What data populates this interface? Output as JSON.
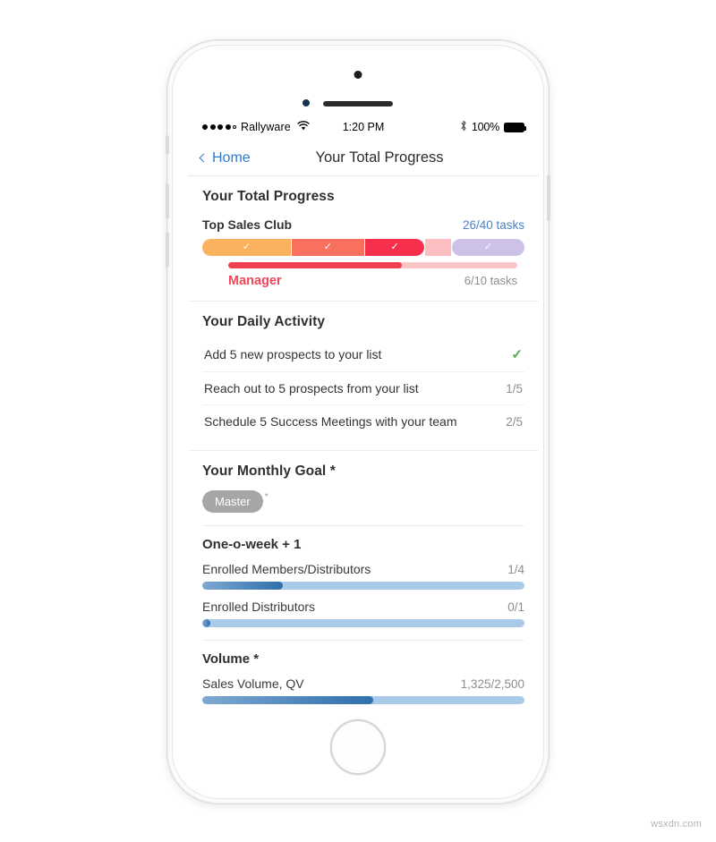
{
  "status_bar": {
    "signal_icon": "signal-dots",
    "carrier": "Rallyware",
    "wifi_icon": "wifi-icon",
    "time": "1:20 PM",
    "bluetooth_icon": "bluetooth-icon",
    "battery_percent": "100%",
    "battery_icon": "battery-full-icon"
  },
  "nav_bar": {
    "back_icon": "chevron-left-icon",
    "back_label": "Home",
    "title": "Your Total Progress"
  },
  "total_progress": {
    "title": "Your Total Progress",
    "club_name": "Top Sales Club",
    "club_tasks": "26/40 tasks",
    "club_tasks_color": "#4d83c4",
    "segments": [
      {
        "name": "segment-1",
        "color": "#fbb25e",
        "width_pct": 27.5,
        "checked": true,
        "check_icon": "check-icon"
      },
      {
        "name": "segment-2",
        "color": "#f9705f",
        "width_pct": 22.5,
        "checked": true,
        "check_icon": "check-icon"
      },
      {
        "name": "segment-3",
        "color": "#f6304c",
        "width_pct": 18.5,
        "checked": true,
        "check_icon": "check-icon"
      },
      {
        "name": "segment-4",
        "color": "#fcbfc1",
        "width_pct": 8.0,
        "checked": false,
        "check_icon": ""
      },
      {
        "name": "segment-5",
        "color": "#cdc1e8",
        "width_pct": 22.5,
        "checked": true,
        "check_icon": "check-icon"
      }
    ],
    "rank_label": "Manager",
    "rank_label_color": "#f1475a",
    "rank_tasks": "6/10 tasks",
    "rank_fill_pct": 60,
    "rank_fill_color": "#ef3f51",
    "rank_track_color": "#fbc5c8"
  },
  "daily_activity": {
    "title": "Your Daily Activity",
    "items": [
      {
        "label": "Add 5 new prospects to your list",
        "value": "",
        "completed": true,
        "check_icon": "check-icon"
      },
      {
        "label": "Reach out to 5 prospects from your list",
        "value": "1/5",
        "completed": false,
        "check_icon": ""
      },
      {
        "label": "Schedule 5 Success Meetings with your team",
        "value": "2/5",
        "completed": false,
        "check_icon": ""
      }
    ]
  },
  "monthly_goal": {
    "title": "Your Monthly Goal *",
    "badge": "Master",
    "badge_asterisk": "*",
    "badge_color": "#a6a6a6",
    "groups": [
      {
        "title": "One-o-week + 1",
        "metrics": [
          {
            "label": "Enrolled Members/Distributors",
            "value": "1/4",
            "fill_pct": 25
          },
          {
            "label": "Enrolled Distributors",
            "value": "0/1",
            "fill_pct": 0
          }
        ]
      },
      {
        "title": "Volume *",
        "metrics": [
          {
            "label": "Sales Volume, QV",
            "value": "1,325/2,500",
            "fill_pct": 53
          }
        ]
      }
    ],
    "bar_fill_start": "#7da9d2",
    "bar_fill_end": "#2f6fac",
    "bar_track": "#a9cae8"
  },
  "watermark": "wsxdn.com"
}
